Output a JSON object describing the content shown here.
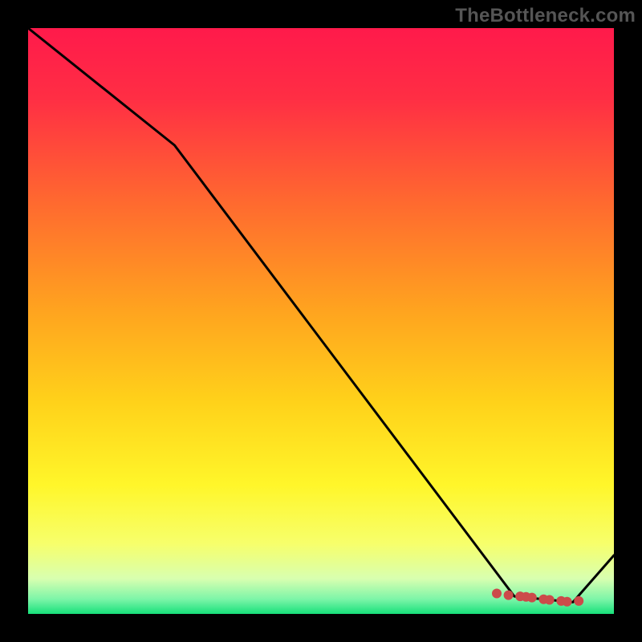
{
  "watermark": "TheBottleneck.com",
  "chart_data": {
    "type": "line",
    "title": "",
    "xlabel": "",
    "ylabel": "",
    "xlim": [
      0,
      100
    ],
    "ylim": [
      0,
      100
    ],
    "grid": false,
    "legend": false,
    "gradient_stops": [
      {
        "offset": 0.0,
        "color": "#ff1a4b"
      },
      {
        "offset": 0.12,
        "color": "#ff2e44"
      },
      {
        "offset": 0.3,
        "color": "#ff6a2f"
      },
      {
        "offset": 0.48,
        "color": "#ffa31f"
      },
      {
        "offset": 0.64,
        "color": "#ffd21a"
      },
      {
        "offset": 0.78,
        "color": "#fff62a"
      },
      {
        "offset": 0.88,
        "color": "#f7ff6b"
      },
      {
        "offset": 0.94,
        "color": "#d8ffb0"
      },
      {
        "offset": 0.975,
        "color": "#7cf5a8"
      },
      {
        "offset": 1.0,
        "color": "#17e07a"
      }
    ],
    "series": [
      {
        "name": "curve",
        "color": "#000000",
        "x": [
          0,
          25,
          83,
          93,
          100
        ],
        "y": [
          100,
          80,
          3,
          2,
          10
        ]
      }
    ],
    "markers": {
      "name": "highlight",
      "color": "#cc4a4a",
      "points": [
        {
          "x": 80,
          "y": 3.5
        },
        {
          "x": 82,
          "y": 3.2
        },
        {
          "x": 84,
          "y": 3.0
        },
        {
          "x": 85,
          "y": 2.9
        },
        {
          "x": 86,
          "y": 2.8
        },
        {
          "x": 88,
          "y": 2.5
        },
        {
          "x": 89,
          "y": 2.4
        },
        {
          "x": 91,
          "y": 2.2
        },
        {
          "x": 92,
          "y": 2.1
        },
        {
          "x": 94,
          "y": 2.2
        }
      ]
    }
  }
}
